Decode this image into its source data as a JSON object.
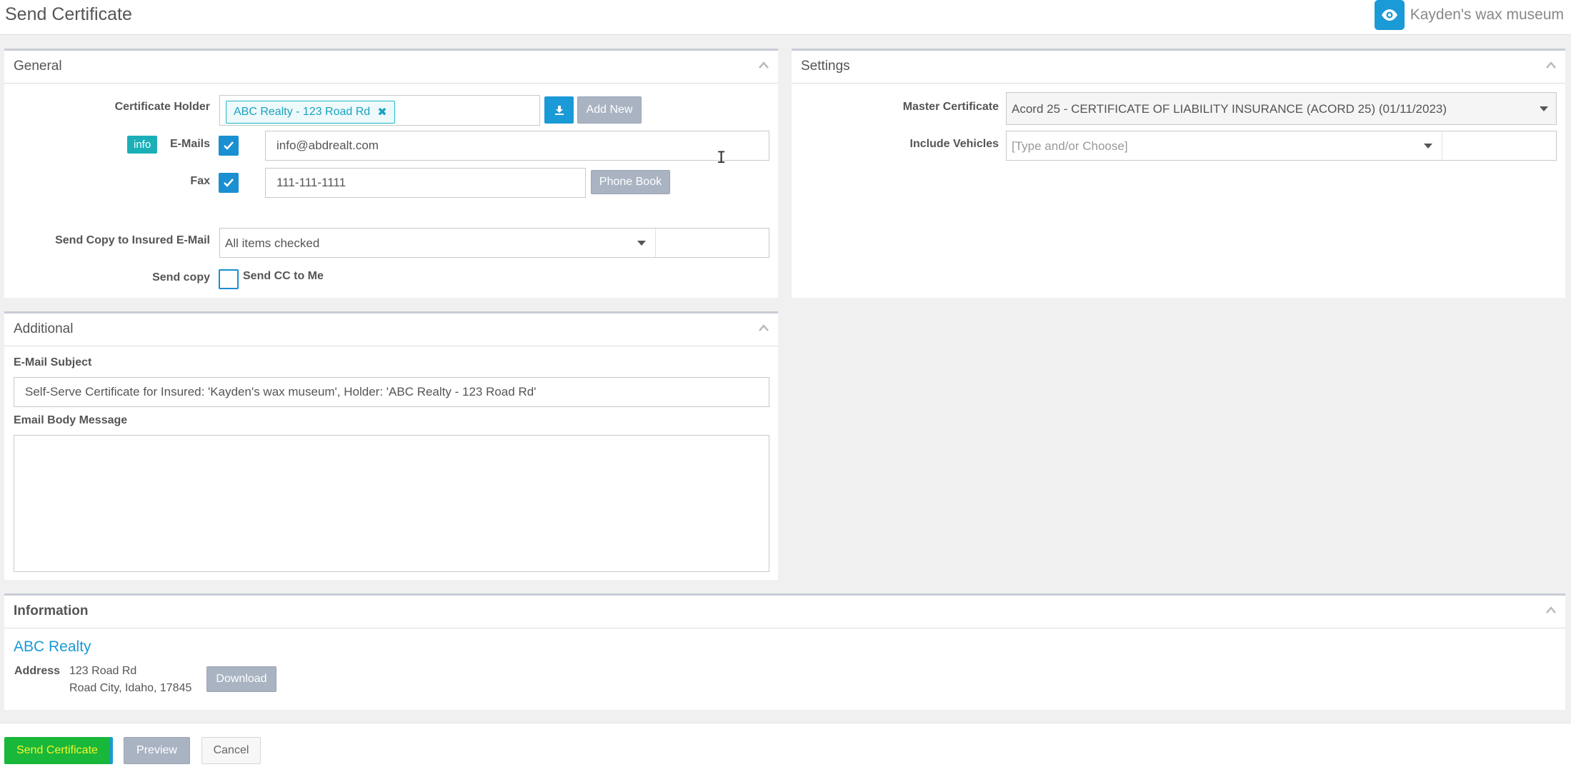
{
  "header": {
    "title": "Send Certificate",
    "insured_name": "Kayden's wax museum"
  },
  "general": {
    "title": "General",
    "certificate_holder_label": "Certificate Holder",
    "certificate_holder_tag": "ABC Realty - 123 Road Rd",
    "add_new_label": "Add New",
    "info_badge": "info",
    "emails_label": "E-Mails",
    "emails_checked": true,
    "emails_value": "info@abdrealt.com",
    "fax_label": "Fax",
    "fax_checked": true,
    "fax_value": "111-111-1111",
    "phone_book_label": "Phone Book",
    "send_copy_insured_label": "Send Copy to Insured E-Mail",
    "send_copy_insured_value": "All items checked",
    "send_copy_label": "Send copy",
    "send_cc_label": "Send CC to Me",
    "send_cc_checked": false
  },
  "settings": {
    "title": "Settings",
    "master_certificate_label": "Master Certificate",
    "master_certificate_value": "Acord 25 - CERTIFICATE OF LIABILITY INSURANCE (ACORD 25) (01/11/2023)",
    "include_vehicles_label": "Include Vehicles",
    "include_vehicles_placeholder": "[Type and/or Choose]"
  },
  "additional": {
    "title": "Additional",
    "email_subject_label": "E-Mail Subject",
    "email_subject_value": "Self-Serve Certificate for Insured: 'Kayden's wax museum', Holder: 'ABC Realty - 123 Road Rd'",
    "email_body_label": "Email Body Message",
    "email_body_value": ""
  },
  "information": {
    "title": "Information",
    "company_name": "ABC Realty",
    "address_label": "Address",
    "address_line1": "123 Road Rd",
    "address_line2": "Road City, Idaho, 17845",
    "download_label": "Download"
  },
  "footer": {
    "send_label": "Send Certificate",
    "preview_label": "Preview",
    "cancel_label": "Cancel"
  },
  "colors": {
    "accent": "#1a9ad6",
    "send_button": "#19b73a",
    "send_text": "#f5f52a",
    "gray_button": "#a9b3c2"
  },
  "icons": {
    "insured": "eye-icon",
    "holder_select": "download-icon",
    "collapse": "chevron-up-icon",
    "check": "check-icon",
    "remove_tag": "close-icon"
  }
}
